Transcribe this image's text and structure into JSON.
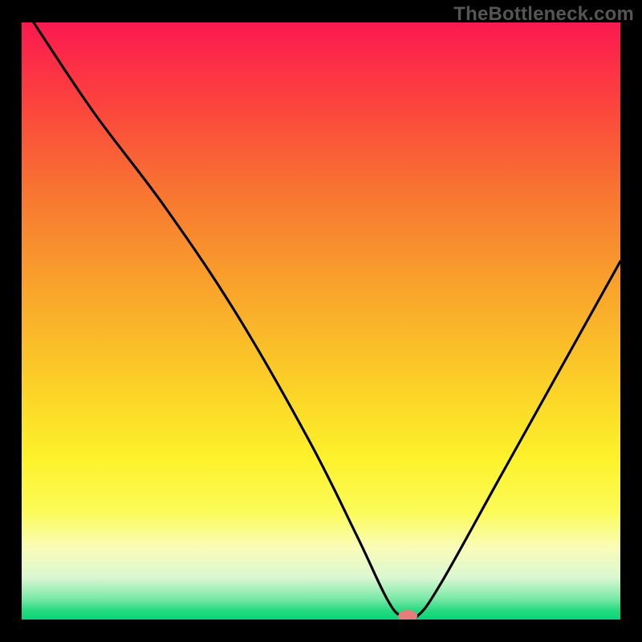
{
  "watermark": "TheBottleneck.com",
  "chart_data": {
    "type": "line",
    "title": "",
    "xlabel": "",
    "ylabel": "",
    "xlim": [
      0,
      100
    ],
    "ylim": [
      0,
      100
    ],
    "grid": false,
    "legend": false,
    "series": [
      {
        "name": "bottleneck-curve",
        "x": [
          2,
          12,
          24,
          36,
          48,
          56,
          61,
          63.5,
          66,
          70,
          80,
          90,
          100
        ],
        "y": [
          100,
          85,
          69,
          51,
          30,
          14,
          3.5,
          0.5,
          0.5,
          6,
          24,
          42,
          60
        ]
      }
    ],
    "marker": {
      "x": 64.5,
      "y": 0.6,
      "rx": 1.6,
      "ry": 1.0,
      "color": "#e47d7b"
    },
    "background_gradient": {
      "stops": [
        {
          "offset": 0.0,
          "color": "#fb1950"
        },
        {
          "offset": 0.12,
          "color": "#fc3e3f"
        },
        {
          "offset": 0.28,
          "color": "#f87431"
        },
        {
          "offset": 0.45,
          "color": "#f9a52b"
        },
        {
          "offset": 0.62,
          "color": "#fbd427"
        },
        {
          "offset": 0.73,
          "color": "#fdf22b"
        },
        {
          "offset": 0.82,
          "color": "#fbfb59"
        },
        {
          "offset": 0.88,
          "color": "#fafcb9"
        },
        {
          "offset": 0.93,
          "color": "#daf7d2"
        },
        {
          "offset": 0.965,
          "color": "#7be9a8"
        },
        {
          "offset": 0.985,
          "color": "#24da80"
        },
        {
          "offset": 1.0,
          "color": "#0ad57a"
        }
      ]
    },
    "baseline_color": "#0ad57a"
  }
}
